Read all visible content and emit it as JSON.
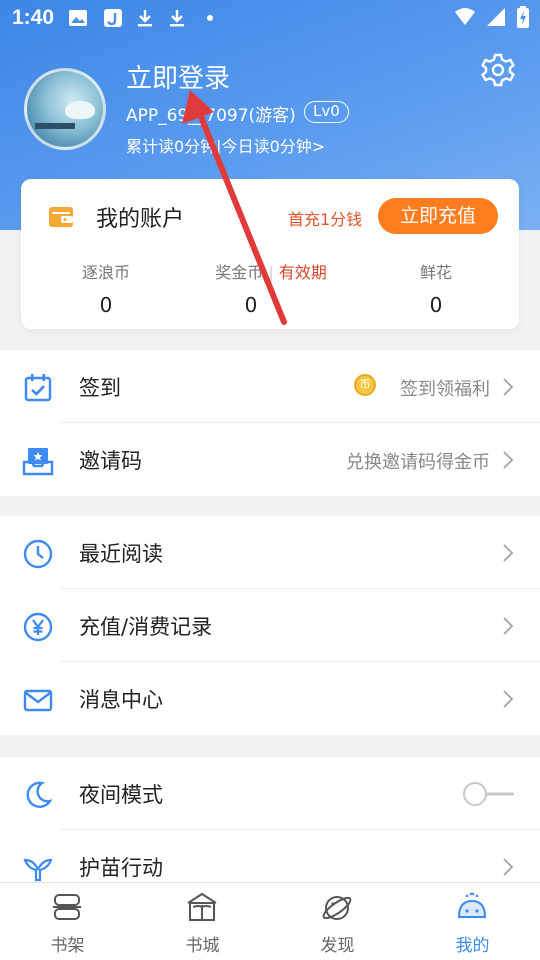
{
  "status_bar": {
    "time": "1:40"
  },
  "profile": {
    "login_title": "立即登录",
    "user_id": "APP_69__7097(游客)",
    "level": "Lv0",
    "read_stats": "累计读0分钟|今日读0分钟>"
  },
  "account": {
    "title": "我的账户",
    "first_charge": "首充1分钱",
    "recharge_button": "立即充值",
    "stats": [
      {
        "label": "逐浪币",
        "value": "0"
      },
      {
        "label": "奖金币",
        "suffix": "有效期",
        "value": "0"
      },
      {
        "label": "鲜花",
        "value": "0"
      }
    ]
  },
  "menu_group_1": [
    {
      "label": "签到",
      "hint": "签到领福利"
    },
    {
      "label": "邀请码",
      "hint": "兑换邀请码得金币"
    }
  ],
  "menu_group_2": [
    {
      "label": "最近阅读"
    },
    {
      "label": "充值/消费记录"
    },
    {
      "label": "消息中心"
    }
  ],
  "menu_group_3": [
    {
      "label": "夜间模式"
    },
    {
      "label": "护苗行动"
    }
  ],
  "coin_glyph": "币",
  "bottom_nav": [
    {
      "label": "书架"
    },
    {
      "label": "书城"
    },
    {
      "label": "发现"
    },
    {
      "label": "我的"
    }
  ],
  "colors": {
    "header_blue": "#3c86e6",
    "accent_orange": "#ff7d1f",
    "active_blue": "#3d8bf2",
    "annotation_red": "#e03a3a"
  }
}
